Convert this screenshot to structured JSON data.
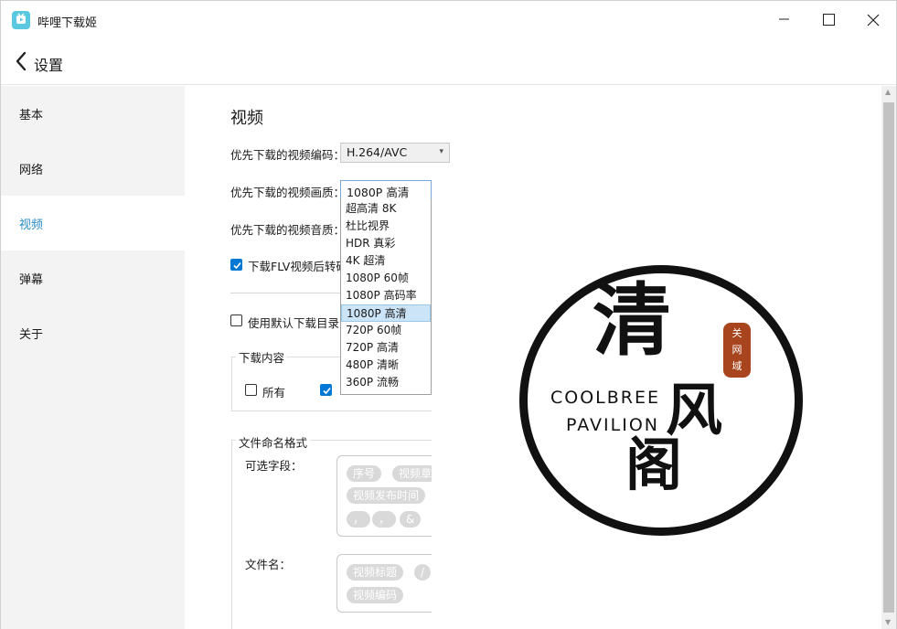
{
  "window": {
    "title": "哔哩下载姬",
    "buttons": [
      "minimize-icon",
      "maximize-icon",
      "close-icon"
    ]
  },
  "header": {
    "back_icon": "chevron-left-icon",
    "title": "设置"
  },
  "sidebar": {
    "items": [
      {
        "label": "基本",
        "active": false
      },
      {
        "label": "网络",
        "active": false
      },
      {
        "label": "视频",
        "active": true
      },
      {
        "label": "弹幕",
        "active": false
      },
      {
        "label": "关于",
        "active": false
      }
    ]
  },
  "video": {
    "section_title": "视频",
    "codec_label": "优先下载的视频编码：",
    "codec_value": "H.264/AVC",
    "quality_label": "优先下载的视频画质：",
    "quality_value": "1080P 高清",
    "quality_options": [
      "超高清 8K",
      "杜比视界",
      "HDR 真彩",
      "4K 超清",
      "1080P 60帧",
      "1080P 高码率",
      "1080P 高清",
      "720P 60帧",
      "720P 高清",
      "480P 清晰",
      "360P 流畅"
    ],
    "quality_selected": "1080P 高清",
    "audio_label": "优先下载的视频音质：",
    "flv_label": "下载FLV视频后转码",
    "flv_checked": true,
    "default_dir_label": "使用默认下载目录",
    "default_dir_checked": false
  },
  "download_content": {
    "title": "下载内容",
    "all_label": "所有",
    "all_checked": false,
    "second_checked": true
  },
  "naming": {
    "title": "文件命名格式",
    "fields_label": "可选字段：",
    "field_tags": [
      "序号",
      "视频章",
      "视频发布时间",
      "，",
      "，",
      "&"
    ],
    "filename_label": "文件名：",
    "filename_tags": [
      "视频标题",
      "/",
      "视频编码"
    ]
  },
  "watermark": {
    "big": "清",
    "mid": "风",
    "low": "阁",
    "english_1": "COOLBREE",
    "english_2": "PAVILION",
    "seal": [
      "关",
      "网",
      "域"
    ],
    "seal_color": "#a8451e"
  },
  "colors": {
    "accent": "#2a8ec7",
    "checkbox": "#0078d4",
    "selection": "#cce4f7"
  }
}
